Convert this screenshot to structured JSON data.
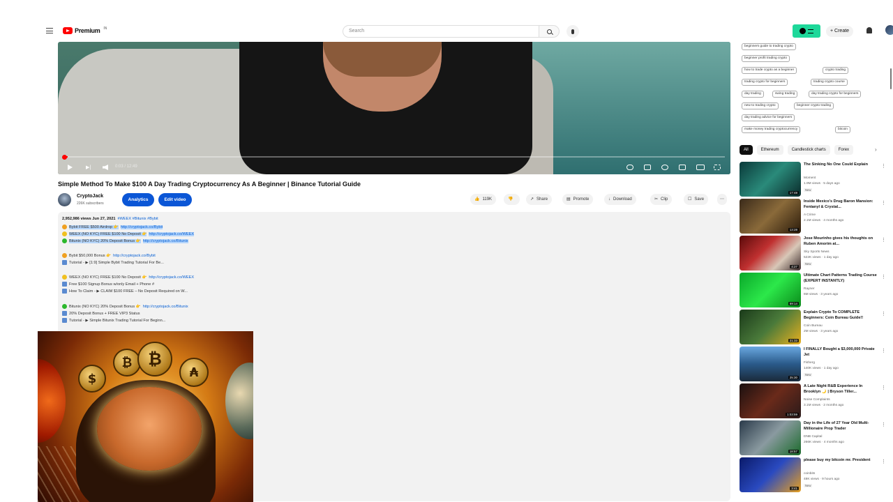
{
  "header": {
    "logo_text": "Premium",
    "logo_sup": "IN",
    "search_placeholder": "Search",
    "create_label": "Create"
  },
  "player": {
    "time": "0:03 / 12:49"
  },
  "video": {
    "title": "Simple Method To Make $100 A Day Trading Cryptocurrency As A Beginner | Binance Tutorial Guide",
    "channel_name": "CryptoJack",
    "channel_subs": "226K subscribers",
    "analytics_label": "Analytics",
    "edit_label": "Edit video",
    "likes": "119K",
    "share_label": "Share",
    "promote_label": "Promote",
    "download_label": "Download",
    "clip_label": "Clip",
    "save_label": "Save"
  },
  "description": {
    "meta": "2,952,986 views  Jun 27, 2021",
    "hashtags": "#WEEX #Bitunix #Bybit",
    "lines": [
      {
        "text": "Bybit FREE $500 Airdrop 👉",
        "link": "http://cryptojack.co/Bybit",
        "color": "#f0a020",
        "hl": true
      },
      {
        "text": "WEEX (NO KYC) FREE $100 No Deposit 👉",
        "link": "http://cryptojack.co/WEEX",
        "color": "#f0c020",
        "hl": true
      },
      {
        "text": "Bitunix (NO KYC) 20% Deposit Bonus 👉",
        "link": "http://cryptojack.co/Bitunix",
        "color": "#2cb82c",
        "hl": true
      },
      {
        "text": "Bybit $50,000 Bonus 👉",
        "link": "http://cryptojack.co/Bybit",
        "color": "#f0a020",
        "hl": false
      },
      {
        "text": "Tutorial - ▶ [1:9] Simple Bybit Trading Tutorial For Be...",
        "link": "",
        "color": "sq",
        "hl": false
      },
      {
        "text": "WEEX (NO KYC) FREE $100 No Deposit 👉",
        "link": "http://cryptojack.co/WEEX",
        "color": "#f0c020",
        "hl": false
      },
      {
        "text": "Free $100 Signup Bonus w/only Email + Phone #",
        "link": "",
        "color": "sq",
        "hl": false
      },
      {
        "text": "How To Claim - ▶ CLAIM $100 FREE – No Deposit Required on W...",
        "link": "",
        "color": "sq",
        "hl": false
      },
      {
        "text": "Bitunix (NO KYC) 20% Deposit Bonus 👉",
        "link": "http://cryptojack.co/Bitunix",
        "color": "#2cb82c",
        "hl": false
      },
      {
        "text": "20% Deposit Bonus + FREE VIP3 Status",
        "link": "",
        "color": "sq",
        "hl": false
      },
      {
        "text": "Tutorial - ▶ Simple Bitunix Trading Tutorial For Beginn...",
        "link": "",
        "color": "sq",
        "hl": false
      }
    ]
  },
  "tags": [
    "beginners guide to trading crypto",
    "beginner profit trading crypto",
    "how to trade crypto as a beginner",
    "crypto trading",
    "trading crypto for beginners",
    "trading crypto course",
    "day trading",
    "swing trading",
    "day trading crypto for beginners",
    "new to trading crypto",
    "beginner crypto trading",
    "day trading advice for beginners",
    "make money trading cryptocurrency",
    "bitcoin"
  ],
  "chips": [
    "All",
    "Ethereum",
    "Candlestick charts",
    "Forex"
  ],
  "recommendations": [
    {
      "title": "The Sinking No One Could Explain",
      "channel": "Moment",
      "views": "1.9M views · 5 days ago",
      "badge": "New",
      "duration": "17:48"
    },
    {
      "title": "Inside Mexico's Drug Baron Mansion: Fentanyl & Crystal...",
      "channel": "A Crime",
      "views": "2.1M views · 4 months ago",
      "badge": "",
      "duration": "13:28"
    },
    {
      "title": "Jose Mourinho gives his thoughts on Ruben Amorim at...",
      "channel": "Sky Sports News",
      "views": "522K views · 1 day ago",
      "badge": "New",
      "duration": "4:27"
    },
    {
      "title": "Ultimate Chart Patterns Trading Course (EXPERT INSTANTLY)",
      "channel": "Rayner",
      "views": "6M views · 3 years ago",
      "badge": "",
      "duration": "59:14"
    },
    {
      "title": "Explain Crypto To COMPLETE Beginners: Coin Bureau Guide!!",
      "channel": "Coin Bureau",
      "views": "2M views · 3 years ago",
      "badge": "",
      "duration": "21:33"
    },
    {
      "title": "I FINALLY Bought a $3,000,000 Private Jet",
      "channel": "Fisherg",
      "views": "140K views · 1 day ago",
      "badge": "New",
      "duration": "25:30"
    },
    {
      "title": "A Late Night R&B Experience In Brooklyn 🌙 | Bryson Tiller...",
      "channel": "Noise Complaints",
      "views": "3.1M views · 2 months ago",
      "badge": "",
      "duration": "1:03:59"
    },
    {
      "title": "Day in the Life of 27 Year Old Multi-Millionaire Prop Trader",
      "channel": "DNB Capital",
      "views": "266K views · 4 months ago",
      "badge": "",
      "duration": "18:57"
    },
    {
      "title": "please buy my bitcoin mr. President",
      "channel": "coinbits",
      "views": "48K views · 9 hours ago",
      "badge": "New",
      "duration": "3:41"
    }
  ]
}
